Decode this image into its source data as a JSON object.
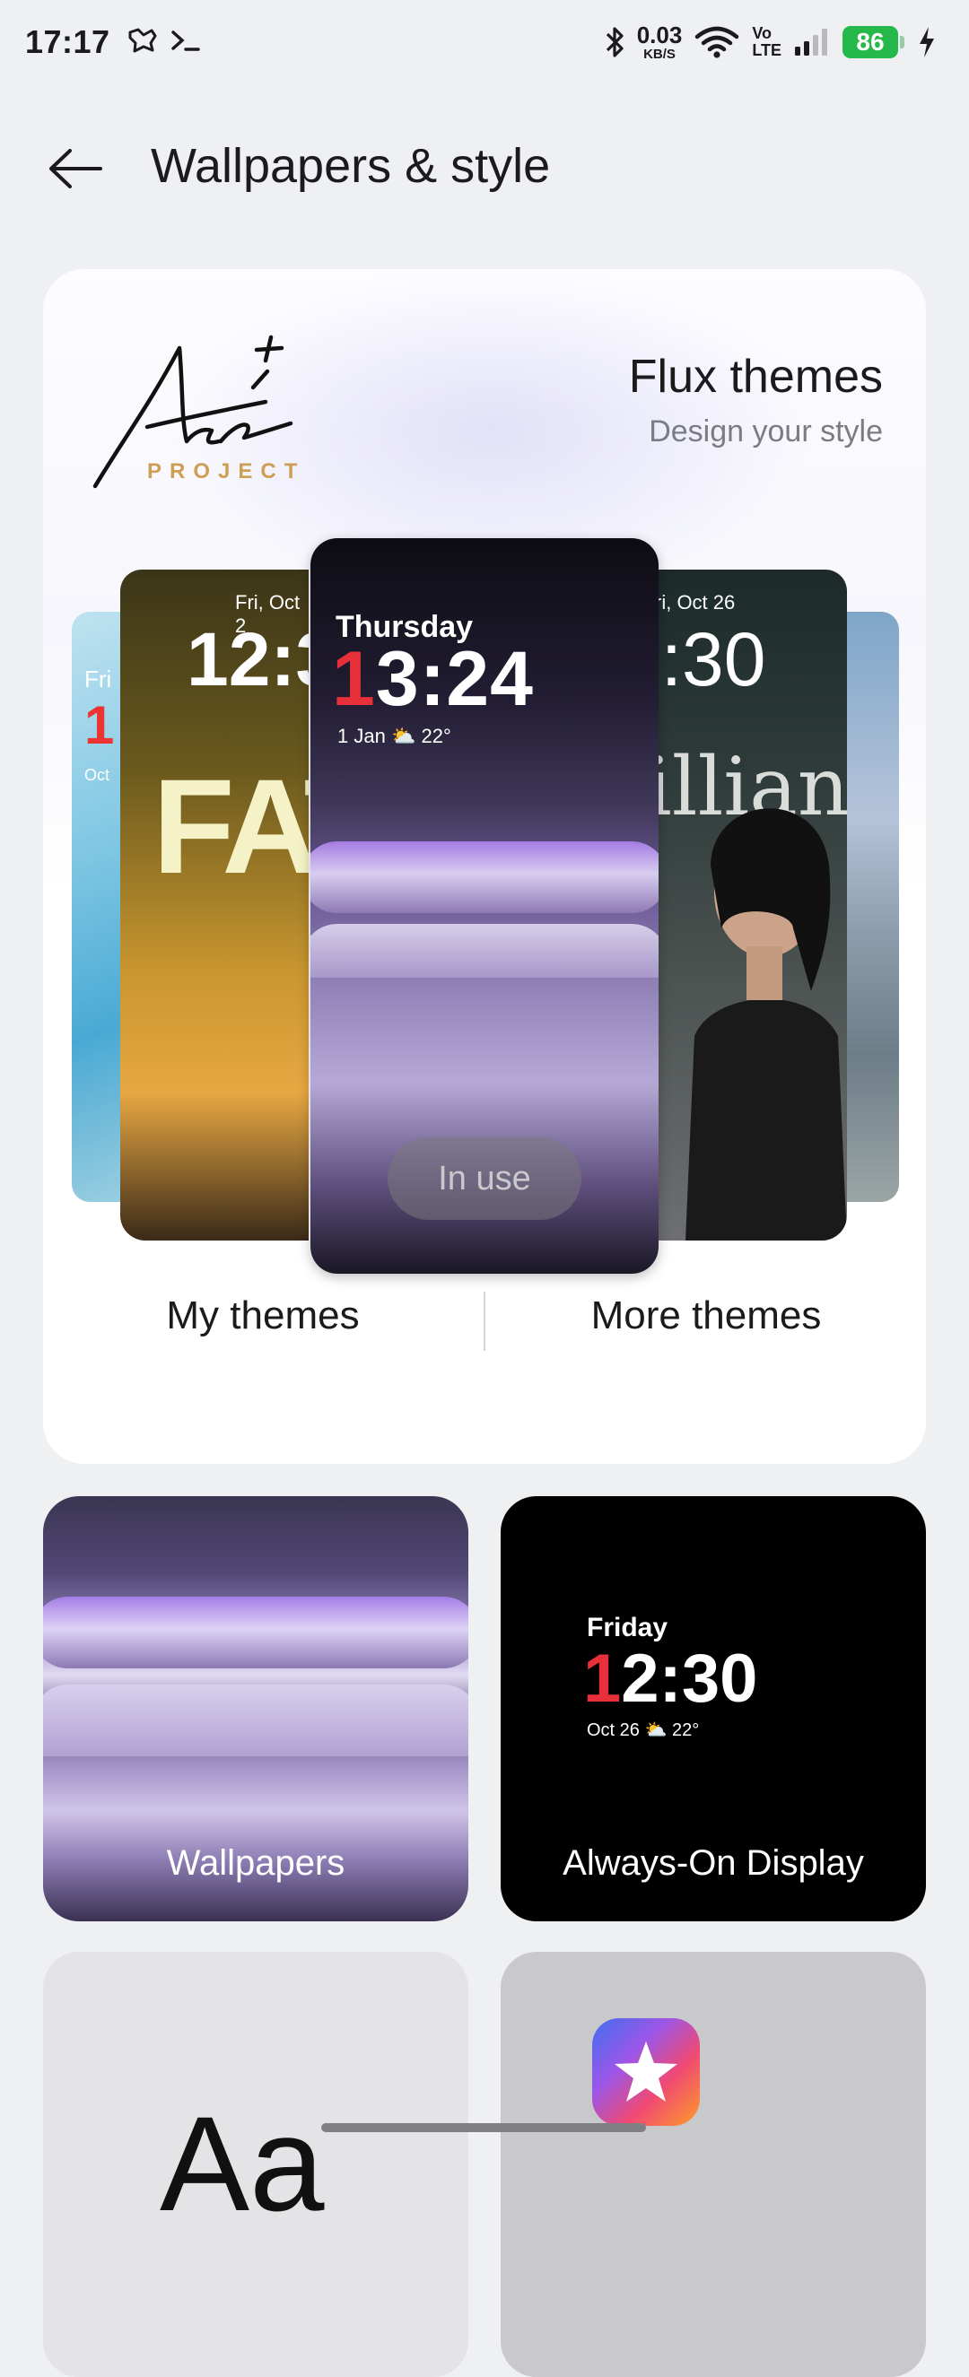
{
  "status_bar": {
    "time": "17:17",
    "net_speed_value": "0.03",
    "net_speed_unit": "KB/S",
    "volte_top": "Vo",
    "volte_bottom": "LTE",
    "battery_level": "86",
    "battery_color": "#25b84a",
    "left_icons": [
      "notification-shield-icon",
      "terminal-icon"
    ],
    "right_icons": [
      "bluetooth-icon",
      "wifi-icon",
      "signal-icon",
      "charging-icon"
    ]
  },
  "header": {
    "title": "Wallpapers & style",
    "back_icon": "back-arrow-icon"
  },
  "flux_card": {
    "logo_subtext": "PROJECT",
    "title": "Flux themes",
    "subtitle": "Design your style",
    "center_preview": {
      "day": "Thursday",
      "time_first_digit": "1",
      "time_rest": "3:24",
      "date": "1 Jan",
      "temperature": "22°",
      "status_button": "In use"
    },
    "left_preview": {
      "date": "Fri, Oct 2",
      "time": "12:3",
      "poster_text": "FAT"
    },
    "right_preview": {
      "date": "ri, Oct 26",
      "time": "2:30",
      "poster_text": "illiant"
    },
    "far_left_preview": {
      "date": "Fri",
      "time": "1",
      "sub": "Oct"
    },
    "my_themes_label": "My themes",
    "more_themes_label": "More themes"
  },
  "tiles": {
    "wallpapers_label": "Wallpapers",
    "aod_label": "Always-On Display",
    "aod_day": "Friday",
    "aod_time_first": "1",
    "aod_time_rest": "2:30",
    "aod_date": "Oct 26",
    "aod_temp": "22°",
    "font_sample": "Aa"
  },
  "colors": {
    "accent_red": "#e8303a",
    "project_gold": "#cf9e55",
    "background": "#eef0f2"
  }
}
